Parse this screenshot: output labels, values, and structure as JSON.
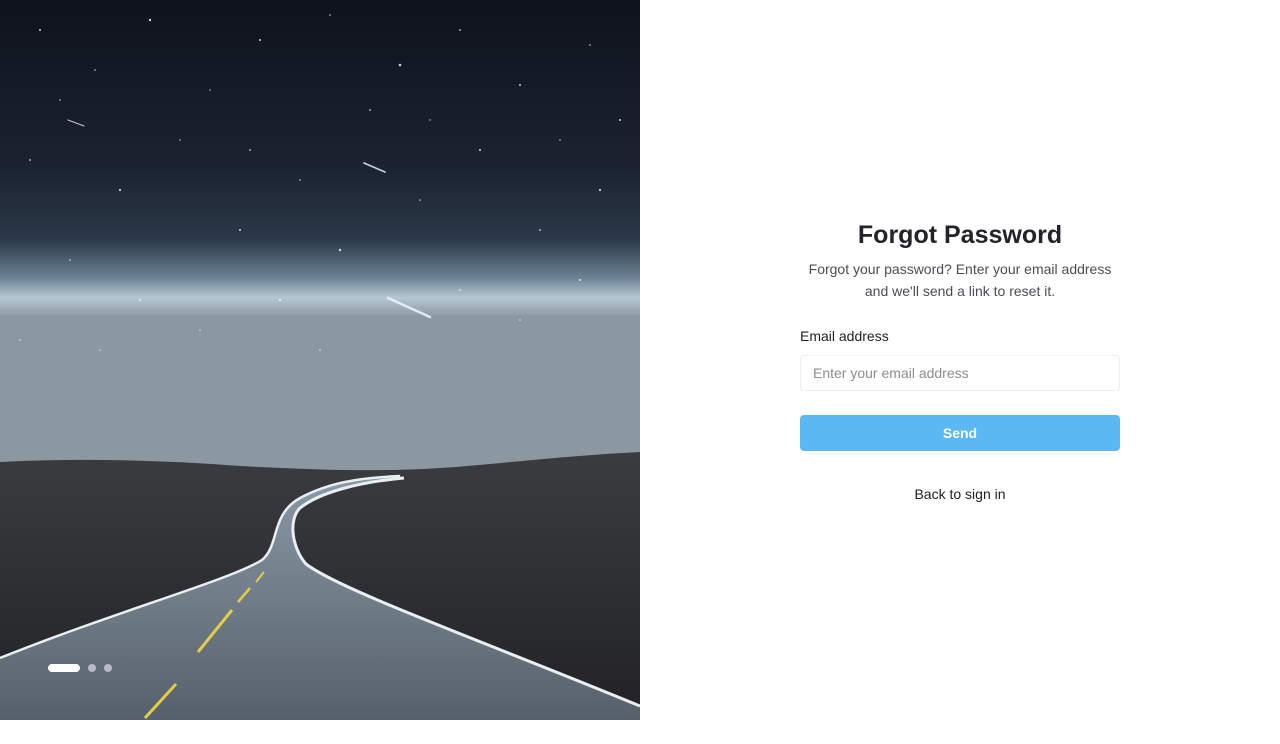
{
  "hero": {
    "image_description_icon": "night-road-photo",
    "carousel": {
      "total_slides": 3,
      "active_slide": 1
    }
  },
  "form": {
    "title": "Forgot Password",
    "subtitle": "Forgot your password? Enter your email address and we'll send a link to reset it.",
    "email_label": "Email address",
    "email_placeholder": "Enter your email address",
    "email_value": "",
    "send_label": "Send",
    "back_label": "Back to sign in"
  },
  "colors": {
    "primary_button": "#5cb8f2",
    "title_text": "#222427",
    "body_text": "#4a4d52"
  }
}
